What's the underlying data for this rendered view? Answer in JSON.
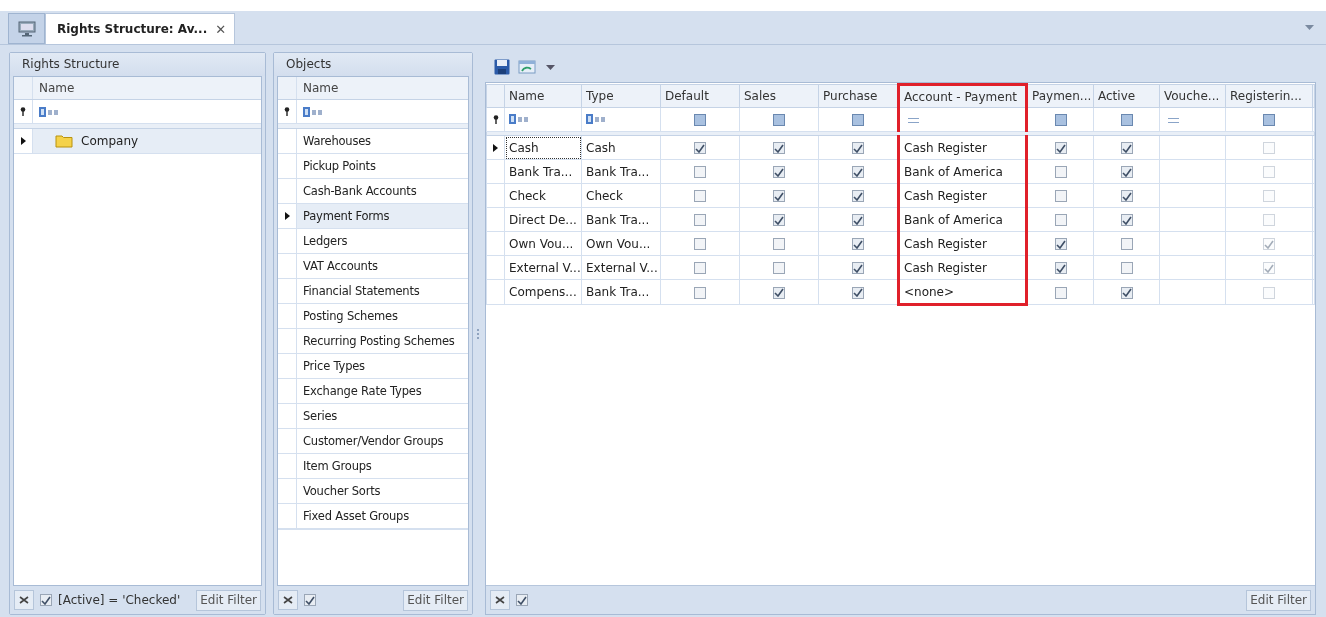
{
  "tab": {
    "title": "Rights Structure: Av...",
    "close": "✕"
  },
  "rights_structure": {
    "title": "Rights Structure",
    "column": "Name",
    "items": [
      {
        "label": "Company",
        "selected": true
      }
    ],
    "filter": {
      "active": true,
      "text": "[Active] = 'Checked'",
      "button": "Edit Filter"
    }
  },
  "objects": {
    "title": "Objects",
    "column": "Name",
    "items": [
      {
        "label": "Warehouses",
        "selected": false
      },
      {
        "label": "Pickup Points",
        "selected": false
      },
      {
        "label": "Cash-Bank Accounts",
        "selected": false
      },
      {
        "label": "Payment Forms",
        "selected": true
      },
      {
        "label": "Ledgers",
        "selected": false
      },
      {
        "label": "VAT Accounts",
        "selected": false
      },
      {
        "label": "Financial Statements",
        "selected": false
      },
      {
        "label": "Posting Schemes",
        "selected": false
      },
      {
        "label": "Recurring Posting Schemes",
        "selected": false
      },
      {
        "label": "Price Types",
        "selected": false
      },
      {
        "label": "Exchange Rate Types",
        "selected": false
      },
      {
        "label": "Series",
        "selected": false
      },
      {
        "label": "Customer/Vendor Groups",
        "selected": false
      },
      {
        "label": "Item Groups",
        "selected": false
      },
      {
        "label": "Voucher Sorts",
        "selected": false
      },
      {
        "label": "Fixed Asset Groups",
        "selected": false
      }
    ],
    "filter": {
      "active": true,
      "button": "Edit Filter"
    }
  },
  "grid": {
    "columns": [
      {
        "label": "Name",
        "kind": "text",
        "highlighted": false,
        "disabled": false
      },
      {
        "label": "Type",
        "kind": "text",
        "highlighted": false,
        "disabled": false
      },
      {
        "label": "Default",
        "kind": "check",
        "highlighted": false,
        "disabled": false
      },
      {
        "label": "Sales",
        "kind": "check",
        "highlighted": false,
        "disabled": false
      },
      {
        "label": "Purchase",
        "kind": "check",
        "highlighted": false,
        "disabled": false
      },
      {
        "label": "Account - Payment",
        "kind": "lookup",
        "highlighted": true,
        "disabled": false
      },
      {
        "label": "Paymen...",
        "kind": "check",
        "highlighted": false,
        "disabled": false
      },
      {
        "label": "Active",
        "kind": "check",
        "highlighted": false,
        "disabled": false
      },
      {
        "label": "Vouche...",
        "kind": "lookup",
        "highlighted": false,
        "disabled": false
      },
      {
        "label": "Registerin...",
        "kind": "check",
        "highlighted": false,
        "disabled": true
      }
    ],
    "rows": [
      {
        "selected": true,
        "cells": [
          "Cash",
          "Cash",
          true,
          true,
          true,
          "Cash Register",
          true,
          true,
          "",
          false
        ]
      },
      {
        "selected": false,
        "cells": [
          "Bank Tra...",
          "Bank Tra...",
          false,
          true,
          true,
          "Bank of America",
          false,
          true,
          "",
          false
        ]
      },
      {
        "selected": false,
        "cells": [
          "Check",
          "Check",
          false,
          true,
          true,
          "Cash Register",
          false,
          true,
          "",
          false
        ]
      },
      {
        "selected": false,
        "cells": [
          "Direct De...",
          "Bank Tra...",
          false,
          true,
          true,
          "Bank of America",
          false,
          true,
          "",
          false
        ]
      },
      {
        "selected": false,
        "cells": [
          "Own Vou...",
          "Own Vou...",
          false,
          false,
          true,
          "Cash Register",
          true,
          false,
          "",
          true
        ]
      },
      {
        "selected": false,
        "cells": [
          "External V...",
          "External V...",
          false,
          false,
          true,
          "Cash Register",
          true,
          false,
          "",
          true
        ]
      },
      {
        "selected": false,
        "cells": [
          "Compens...",
          "Bank Tra...",
          false,
          true,
          true,
          "<none>",
          false,
          true,
          "",
          false
        ]
      }
    ],
    "filter": {
      "active": true,
      "button": "Edit Filter"
    }
  }
}
